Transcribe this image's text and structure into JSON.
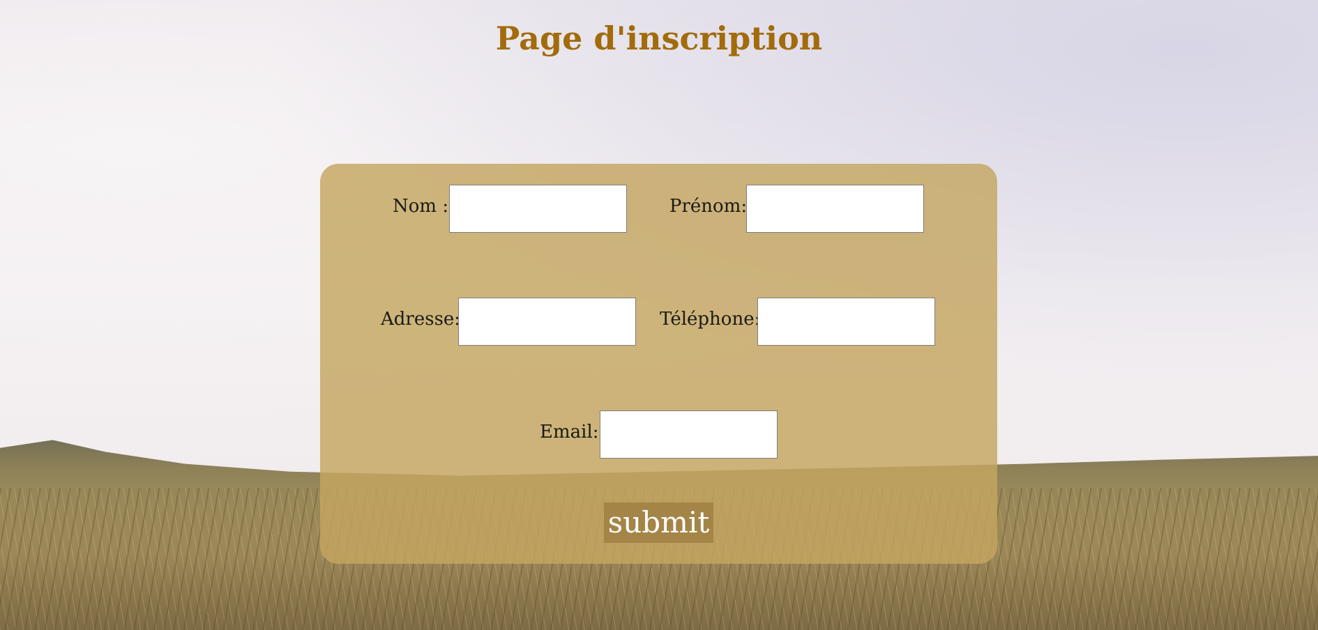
{
  "page": {
    "title": "Page d'inscription"
  },
  "form": {
    "fields": {
      "nom": {
        "label": "Nom :",
        "value": "",
        "placeholder": ""
      },
      "prenom": {
        "label": "Prénom:",
        "value": "",
        "placeholder": ""
      },
      "adresse": {
        "label": "Adresse:",
        "value": "",
        "placeholder": ""
      },
      "telephone": {
        "label": "Téléphone:",
        "value": "",
        "placeholder": ""
      },
      "email": {
        "label": "Email:",
        "value": "",
        "placeholder": ""
      }
    },
    "submit_label": "submit"
  },
  "colors": {
    "title": "#a26b0b",
    "card_background": "#c4a660",
    "submit_background": "#a48547",
    "submit_text": "#ffffff"
  }
}
